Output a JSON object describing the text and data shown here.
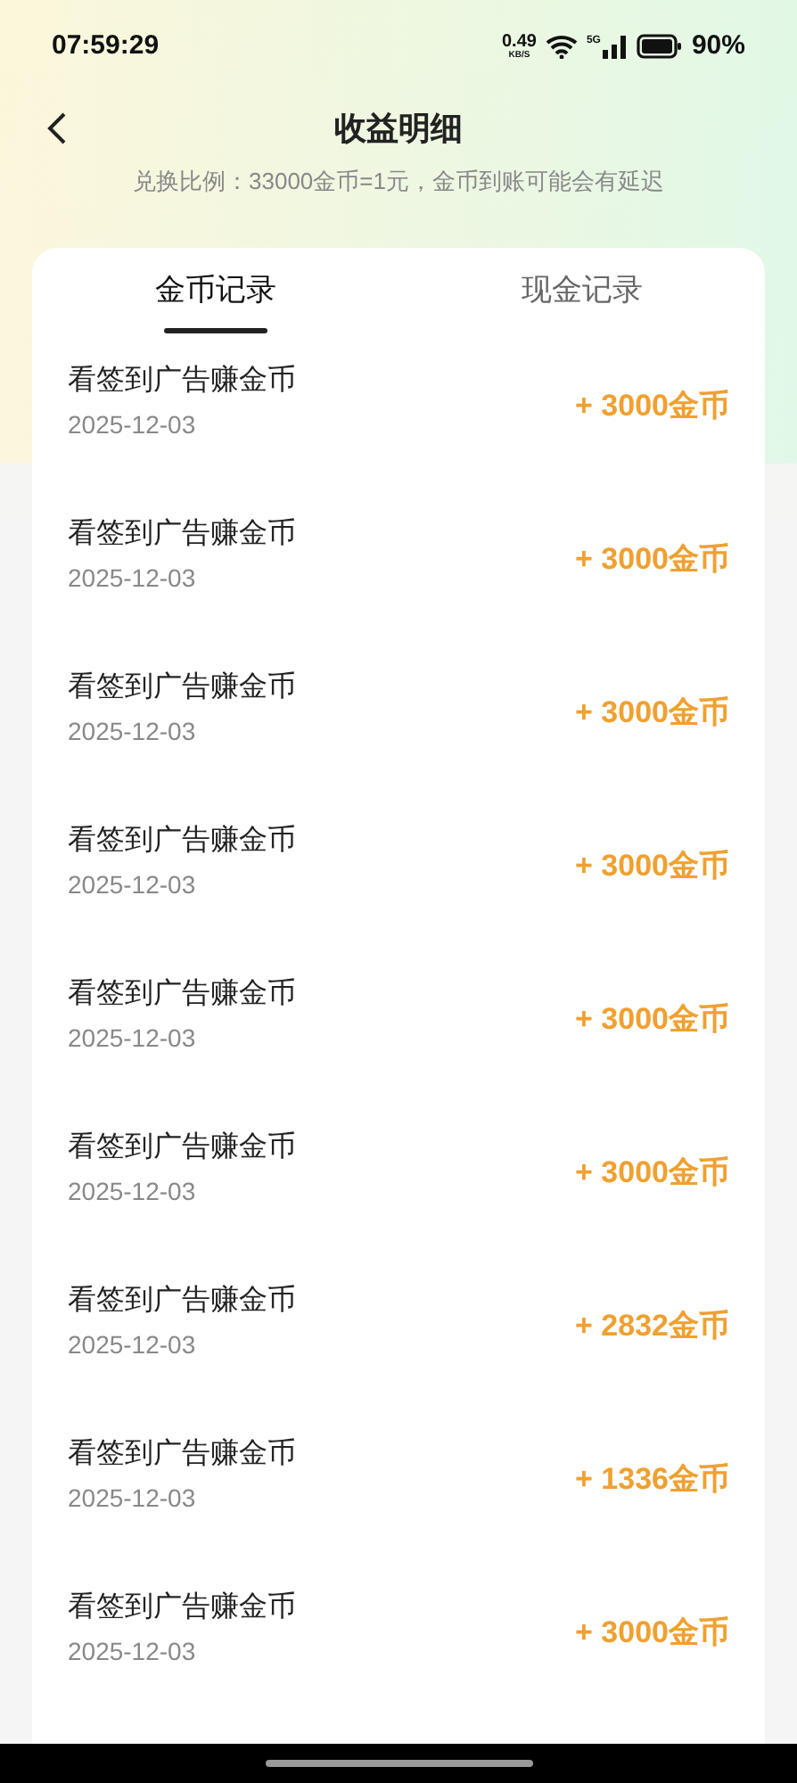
{
  "status_bar": {
    "time": "07:59:29",
    "net_speed": "0.49",
    "net_unit": "KB/S",
    "network": "5G",
    "battery": "90%"
  },
  "header": {
    "title": "收益明细",
    "subtitle": "兑换比例：33000金币=1元，金币到账可能会有延迟"
  },
  "tabs": [
    {
      "label": "金币记录",
      "selected": true
    },
    {
      "label": "现金记录",
      "selected": false
    }
  ],
  "records": [
    {
      "title": "看签到广告赚金币",
      "date": "2025-12-03",
      "amount": "+ 3000金币"
    },
    {
      "title": "看签到广告赚金币",
      "date": "2025-12-03",
      "amount": "+ 3000金币"
    },
    {
      "title": "看签到广告赚金币",
      "date": "2025-12-03",
      "amount": "+ 3000金币"
    },
    {
      "title": "看签到广告赚金币",
      "date": "2025-12-03",
      "amount": "+ 3000金币"
    },
    {
      "title": "看签到广告赚金币",
      "date": "2025-12-03",
      "amount": "+ 3000金币"
    },
    {
      "title": "看签到广告赚金币",
      "date": "2025-12-03",
      "amount": "+ 3000金币"
    },
    {
      "title": "看签到广告赚金币",
      "date": "2025-12-03",
      "amount": "+ 2832金币"
    },
    {
      "title": "看签到广告赚金币",
      "date": "2025-12-03",
      "amount": "+ 1336金币"
    },
    {
      "title": "看签到广告赚金币",
      "date": "2025-12-03",
      "amount": "+ 3000金币"
    }
  ]
}
